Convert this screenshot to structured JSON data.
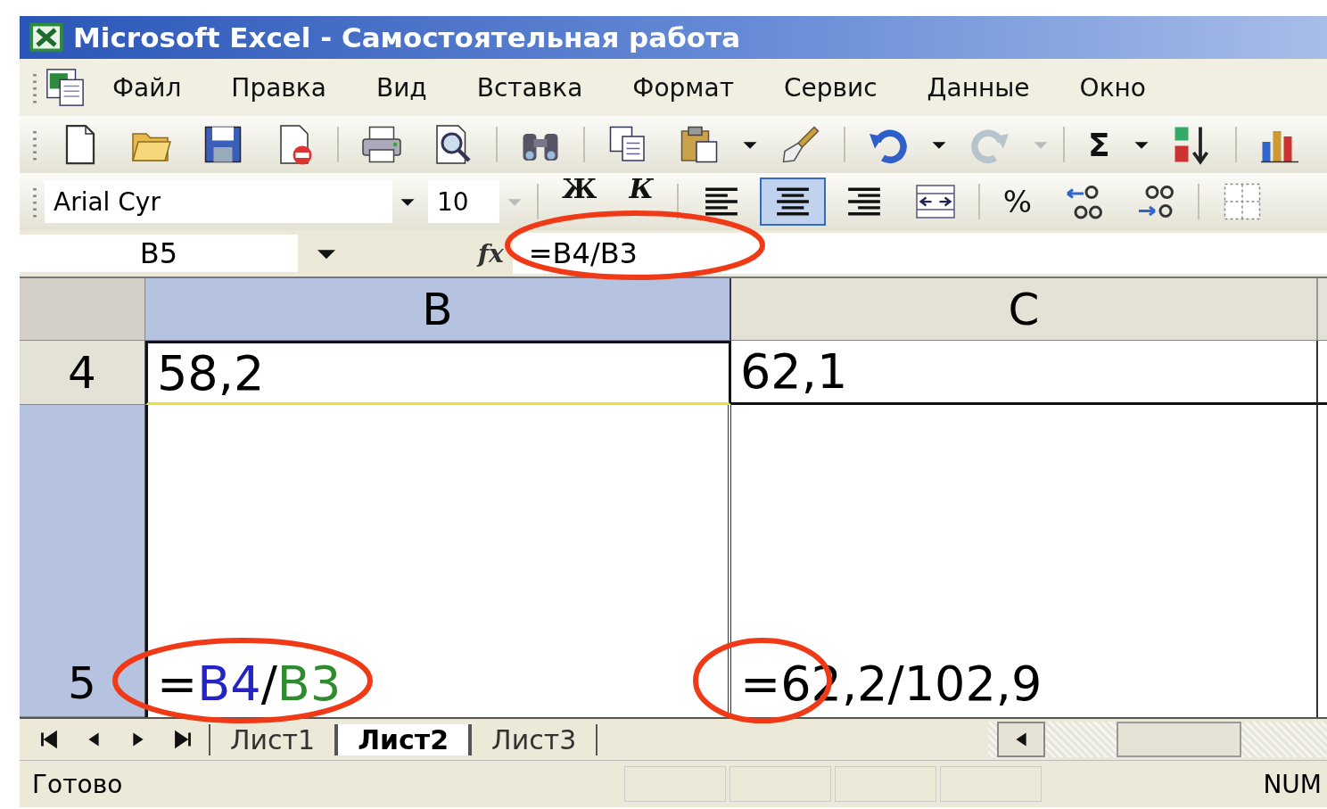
{
  "window": {
    "title": "Microsoft Excel - Самостоятельная работа"
  },
  "menu": [
    "Файл",
    "Правка",
    "Вид",
    "Вставка",
    "Формат",
    "Сервис",
    "Данные",
    "Окно"
  ],
  "standard_toolbar": {
    "sum": "Σ"
  },
  "formatting_toolbar": {
    "font": "Arial Cyr",
    "size": "10",
    "bold": "Ж",
    "italic": "К",
    "alignment": [
      {
        "selected": false
      },
      {
        "selected": true
      },
      {
        "selected": false
      }
    ],
    "percent": "%"
  },
  "formula_bar": {
    "name_box": "B5",
    "fx": "fx",
    "formula": "=B4/B3"
  },
  "sheet": {
    "columns": [
      {
        "label": "B",
        "selected": true
      },
      {
        "label": "C",
        "selected": false
      }
    ],
    "rows": [
      {
        "label": "4",
        "selected": false,
        "cells": [
          {
            "parts": [
              {
                "text": "58,2",
                "color": "#000000"
              }
            ]
          },
          {
            "parts": [
              {
                "text": "62,1",
                "color": "#000000"
              }
            ]
          }
        ]
      },
      {
        "label": "5",
        "selected": true,
        "cells": [
          {
            "parts": [
              {
                "text": "=",
                "color": "#000000"
              },
              {
                "text": "B4",
                "color": "#2323c8"
              },
              {
                "text": "/",
                "color": "#000000"
              },
              {
                "text": "B3",
                "color": "#2e8b2e"
              }
            ]
          },
          {
            "parts": [
              {
                "text": "=62,2/102,9",
                "color": "#000000"
              }
            ]
          }
        ]
      }
    ]
  },
  "sheet_tabs": [
    {
      "label": "Лист1",
      "selected": false
    },
    {
      "label": "Лист2",
      "selected": true
    },
    {
      "label": "Лист3",
      "selected": false
    }
  ],
  "status_bar": {
    "message": "Готово",
    "indicator": "NUM"
  }
}
